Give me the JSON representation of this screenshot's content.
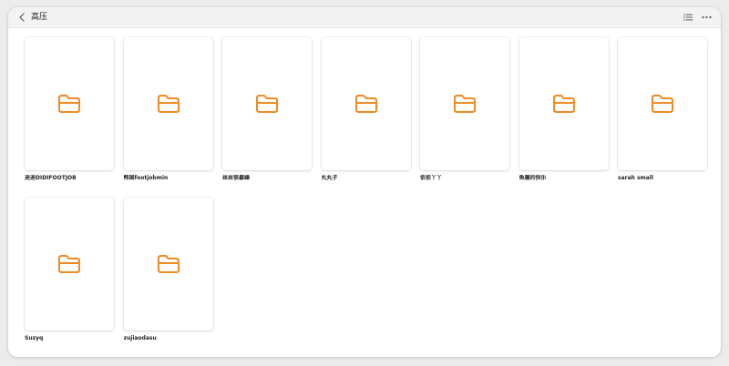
{
  "window": {
    "title": "高压"
  },
  "icons": {
    "back": "chevron-left-icon",
    "list_view": "list-icon",
    "more": "more-horizontal-icon",
    "folder": "folder-icon"
  },
  "colors": {
    "folder_accent": "#f08a24"
  },
  "folders": [
    {
      "name": "迪迪DIDIFOOTJOB"
    },
    {
      "name": "韩国footjobmin"
    },
    {
      "name": "丝丝很暴躁"
    },
    {
      "name": "丸丸子"
    },
    {
      "name": "依依丫丫"
    },
    {
      "name": "鱼膳的快乐"
    },
    {
      "name": "sarah small"
    },
    {
      "name": "Suzyq"
    },
    {
      "name": "zujiaodasu"
    }
  ]
}
